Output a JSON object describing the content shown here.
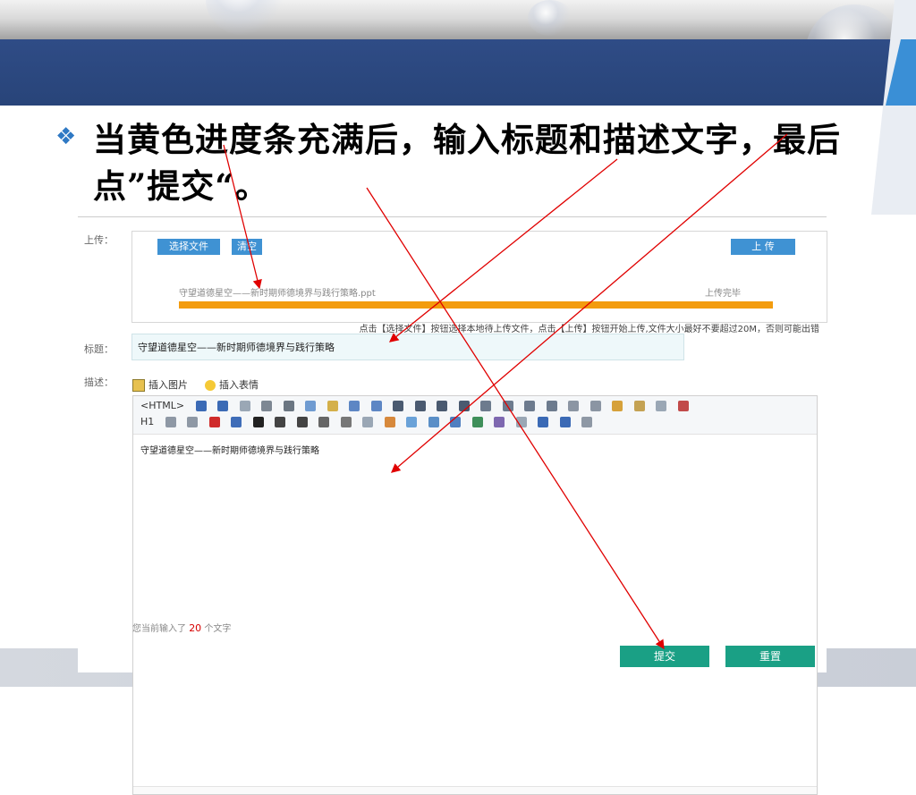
{
  "slide": {
    "bullet_icon": "diamond-bullet-icon",
    "title": "当黄色进度条充满后，输入标题和描述文字，最后点”提交“。"
  },
  "form": {
    "upload_label": "上传：",
    "select_file_button": "选择文件",
    "clear_button": "清空",
    "upload_button": "上 传",
    "file_name": "守望道德星空——新时期师德境界与践行策略.ppt",
    "upload_status": "上传完毕",
    "progress_fraction": 1.0,
    "progress_color": "#f39c0e",
    "upload_hint": "点击【选择文件】按钮选择本地待上传文件，点击【上传】按钮开始上传,文件大小最好不要超过20M，否则可能出错",
    "title_label": "标题：",
    "title_value": "守望道德星空——新时期师德境界与践行策略",
    "desc_label": "描述：",
    "insert_image": "插入图片",
    "insert_emoji": "插入表情",
    "toolbar_html": "<HTML>",
    "toolbar_h1": "H1",
    "editor_content": "守望道德星空——新时期师德境界与践行策略",
    "count_prefix": "您当前输入了",
    "count_value": "20",
    "count_suffix": "个文字",
    "submit_button": "提交",
    "reset_button": "重置"
  },
  "colors": {
    "header_band": "#2f4c86",
    "bullet": "#2f79c4",
    "button_blue": "#3f92d3",
    "button_green": "#1aa085",
    "arrow": "#e00000"
  }
}
